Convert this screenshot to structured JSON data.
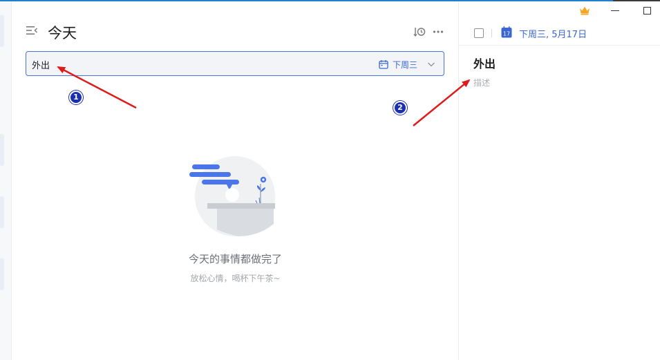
{
  "header": {
    "title": "今天"
  },
  "task_input": {
    "value": "外出",
    "due_label": "下周三"
  },
  "empty_state": {
    "title": "今天的事情都做完了",
    "subtitle": "放松心情，喝杯下午茶~"
  },
  "detail": {
    "date_icon_day": "17",
    "date_text": "下周三, 5月17日",
    "task_title": "外出",
    "description_placeholder": "描述"
  },
  "annotations": [
    {
      "label": "1"
    },
    {
      "label": "2"
    }
  ],
  "icons": {
    "menu": "menu-collapse-icon",
    "sort": "sort-clock-icon",
    "more": "more-dots-icon",
    "calendar": "calendar-icon",
    "chevron": "chevron-down-icon",
    "crown": "crown-icon"
  },
  "colors": {
    "accent": "#3a67d4",
    "input_border": "#4b73d6",
    "crown": "#f5a623",
    "arrow": "#e01b1b",
    "badge": "#1c2fb3"
  }
}
